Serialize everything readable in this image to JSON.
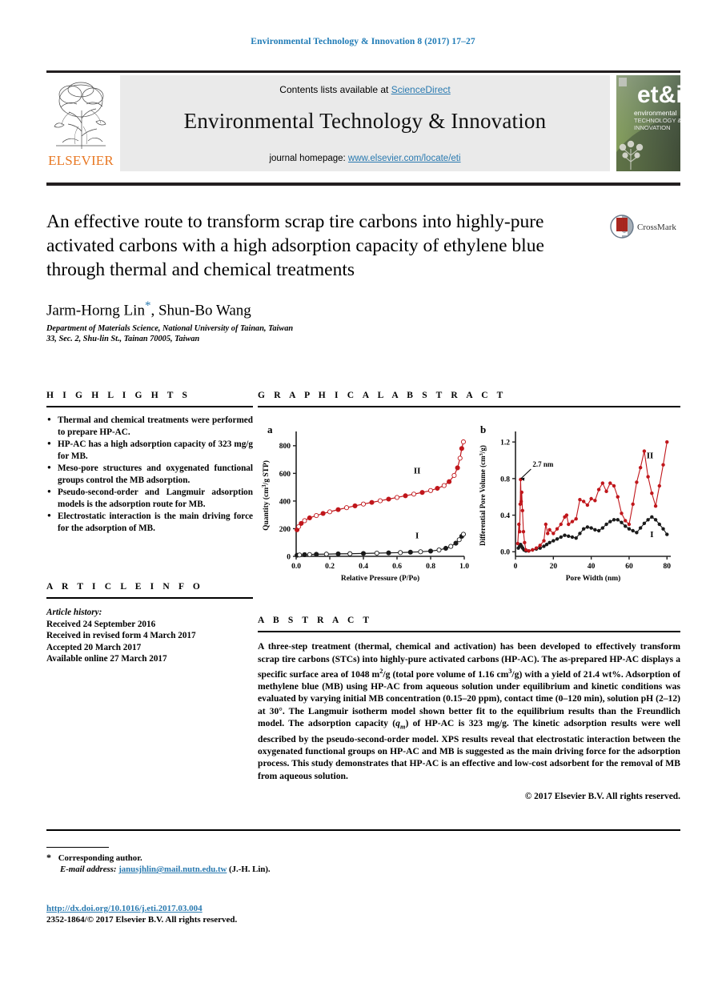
{
  "running_head": "Environmental Technology & Innovation 8 (2017) 17–27",
  "masthead": {
    "contents_prefix": "Contents lists available at ",
    "sciencedirect": "ScienceDirect",
    "journal_title": "Environmental Technology & Innovation",
    "homepage_prefix": "journal homepage: ",
    "homepage_url": "www.elsevier.com/locate/eti",
    "publisher_wordmark": "ELSEVIER",
    "cover_title_line1": "et&i",
    "cover_sub1": "environmental",
    "cover_sub2": "TECHNOLOGY &",
    "cover_sub3": "INNOVATION",
    "link_color": "#2a7ab0",
    "band_color": "#eaeaea",
    "elsevier_orange": "#E87722"
  },
  "title_block": {
    "title": "An effective route to transform scrap tire carbons into highly-pure activated carbons with a high adsorption capacity of ethylene blue through thermal and chemical treatments",
    "crossmark_label": "CrossMark",
    "authors": "Jarm-Horng Lin",
    "author_star": "*",
    "authors_rest": ", Shun-Bo Wang",
    "affiliation_line1": "Department of Materials Science, National University of Tainan, Taiwan",
    "affiliation_line2": "33, Sec. 2, Shu-lin St., Tainan 70005, Taiwan"
  },
  "highlights": {
    "heading": "H I G H L I G H T S",
    "items": [
      "Thermal and chemical treatments were performed to prepare HP-AC.",
      "HP-AC has a high adsorption capacity of 323 mg/g for MB.",
      "Meso-pore structures and oxygenated functional groups control the MB adsorption.",
      "Pseudo-second-order and Langmuir adsorption models is the adsorption route for MB.",
      "Electrostatic interaction is the main driving force for the adsorption of MB."
    ]
  },
  "article_info": {
    "heading": "A R T I C L E    I N F O",
    "history_label": "Article history:",
    "lines": [
      "Received 24 September 2016",
      "Received in revised form 4 March 2017",
      "Accepted 20 March 2017",
      "Available online 27 March 2017"
    ]
  },
  "graphical_abstract": {
    "heading": "G R A P H I C A L   A B S T R A C T"
  },
  "abstract": {
    "heading": "A B S T R A C T",
    "text": "A three-step treatment (thermal, chemical and activation) has been developed to effectively transform scrap tire carbons (STCs) into highly-pure activated carbons (HP-AC). The as-prepared HP-AC displays a specific surface area of 1048 m2/g (total pore volume of 1.16 cm3/g) with a yield of 21.4 wt%. Adsorption of methylene blue (MB) using HP-AC from aqueous solution under equilibrium and kinetic conditions was evaluated by varying initial MB concentration (0.15–20 ppm), contact time (0–120 min), solution pH (2–12) at 30°. The Langmuir isotherm model shown better fit to the equilibrium results than the Freundlich model. The adsorption capacity (qm) of HP-AC is 323 mg/g. The kinetic adsorption results were well described by the pseudo-second-order model. XPS results reveal that electrostatic interaction between the oxygenated functional groups on HP-AC and MB is suggested as the main driving force for the adsorption process. This study demonstrates that HP-AC is an effective and low-cost adsorbent for the removal of MB from aqueous solution.",
    "copyright": "© 2017 Elsevier B.V. All rights reserved."
  },
  "footnote": {
    "corresponding": "Corresponding author.",
    "email_label": "E-mail address:",
    "email": "janusjhlin@mail.nutn.edu.tw",
    "email_attrib": "(J.-H. Lin).",
    "doi": "http://dx.doi.org/10.1016/j.eti.2017.03.004",
    "issn_line": "2352-1864/© 2017 Elsevier B.V. All rights reserved."
  },
  "chart_data": [
    {
      "type": "scatter",
      "panel": "a",
      "title": "",
      "xlabel": "Relative Pressure (P/Po)",
      "ylabel": "Quantity (cm3/g STP)",
      "xlim": [
        0.0,
        1.0
      ],
      "ylim": [
        0,
        880
      ],
      "xticks": [
        0.0,
        0.2,
        0.4,
        0.6,
        0.8,
        1.0
      ],
      "yticks": [
        0,
        200,
        400,
        600,
        800
      ],
      "grid": false,
      "legend": [
        "I",
        "II"
      ],
      "annotations": [
        {
          "text": "II",
          "x": 0.72,
          "y": 600
        },
        {
          "text": "I",
          "x": 0.72,
          "y": 130
        }
      ],
      "series": [
        {
          "name": "I",
          "color": "#1a1a1a",
          "x": [
            0.005,
            0.02,
            0.05,
            0.08,
            0.12,
            0.18,
            0.25,
            0.32,
            0.4,
            0.48,
            0.55,
            0.62,
            0.68,
            0.74,
            0.8,
            0.85,
            0.89,
            0.92,
            0.95,
            0.97,
            0.985,
            0.995
          ],
          "y": [
            8,
            10,
            12,
            13,
            15,
            16,
            18,
            19,
            21,
            23,
            25,
            27,
            30,
            33,
            38,
            46,
            58,
            72,
            95,
            120,
            145,
            160
          ]
        },
        {
          "name": "II",
          "color": "#c0161b",
          "x": [
            0.005,
            0.015,
            0.03,
            0.05,
            0.08,
            0.12,
            0.16,
            0.2,
            0.25,
            0.3,
            0.35,
            0.4,
            0.45,
            0.5,
            0.55,
            0.6,
            0.65,
            0.7,
            0.75,
            0.8,
            0.84,
            0.88,
            0.91,
            0.94,
            0.96,
            0.975,
            0.985,
            0.995
          ],
          "y": [
            192,
            215,
            238,
            258,
            278,
            295,
            310,
            322,
            338,
            352,
            365,
            378,
            390,
            402,
            414,
            426,
            438,
            450,
            462,
            476,
            492,
            512,
            540,
            585,
            640,
            710,
            780,
            828
          ]
        }
      ]
    },
    {
      "type": "line",
      "panel": "b",
      "title": "",
      "xlabel": "Pore Width (nm)",
      "ylabel": "Differential Pore Volume (cm3/g)",
      "xlim": [
        0,
        82
      ],
      "ylim": [
        -0.05,
        1.28
      ],
      "xticks": [
        0,
        20,
        40,
        60,
        80
      ],
      "yticks": [
        0.0,
        0.4,
        0.8,
        1.2
      ],
      "grid": false,
      "legend": [
        "I",
        "II"
      ],
      "annotations": [
        {
          "text": "2.7 nm",
          "x": 6.5,
          "y": 0.93
        },
        {
          "text": "II",
          "x": 71,
          "y": 1.02
        },
        {
          "text": "I",
          "x": 72,
          "y": 0.16
        }
      ],
      "series": [
        {
          "name": "I",
          "color": "#1a1a1a",
          "x": [
            1.5,
            2.2,
            2.7,
            3.2,
            3.8,
            4.5,
            5.5,
            7,
            9,
            11,
            13,
            15,
            16.5,
            18,
            20,
            22,
            24,
            26,
            28,
            30,
            32,
            34,
            36,
            38,
            40,
            42,
            44,
            46,
            48,
            50,
            52,
            54,
            56,
            58,
            60,
            62,
            64,
            66,
            68,
            70,
            72,
            74,
            76,
            78,
            80
          ],
          "y": [
            0.04,
            0.06,
            0.08,
            0.06,
            0.04,
            0.02,
            0.01,
            0.01,
            0.02,
            0.03,
            0.04,
            0.06,
            0.08,
            0.1,
            0.12,
            0.14,
            0.16,
            0.18,
            0.17,
            0.16,
            0.15,
            0.2,
            0.25,
            0.27,
            0.26,
            0.24,
            0.23,
            0.26,
            0.3,
            0.33,
            0.35,
            0.35,
            0.32,
            0.28,
            0.25,
            0.23,
            0.21,
            0.26,
            0.31,
            0.35,
            0.38,
            0.35,
            0.3,
            0.25,
            0.19
          ]
        },
        {
          "name": "II",
          "color": "#c0161b",
          "x": [
            1.2,
            1.8,
            2.2,
            2.5,
            2.7,
            3.0,
            3.3,
            3.7,
            4.2,
            4.8,
            5.5,
            7,
            9,
            11,
            13,
            15,
            16,
            17,
            18,
            20,
            22,
            24,
            26,
            27,
            28,
            30,
            32,
            34,
            36,
            38,
            40,
            42,
            44,
            46,
            48,
            50,
            52,
            54,
            56,
            58,
            60,
            62,
            64,
            66,
            68,
            70,
            72,
            74,
            76,
            78,
            80
          ],
          "y": [
            0.09,
            0.3,
            0.22,
            0.52,
            0.79,
            0.55,
            0.65,
            0.45,
            0.22,
            0.1,
            0.02,
            0.01,
            0.02,
            0.04,
            0.07,
            0.12,
            0.3,
            0.2,
            0.24,
            0.2,
            0.25,
            0.3,
            0.38,
            0.4,
            0.3,
            0.33,
            0.36,
            0.57,
            0.55,
            0.51,
            0.58,
            0.56,
            0.68,
            0.75,
            0.66,
            0.75,
            0.72,
            0.6,
            0.42,
            0.34,
            0.3,
            0.52,
            0.76,
            0.92,
            1.1,
            0.82,
            0.64,
            0.5,
            0.72,
            0.95,
            1.2
          ]
        }
      ]
    }
  ]
}
